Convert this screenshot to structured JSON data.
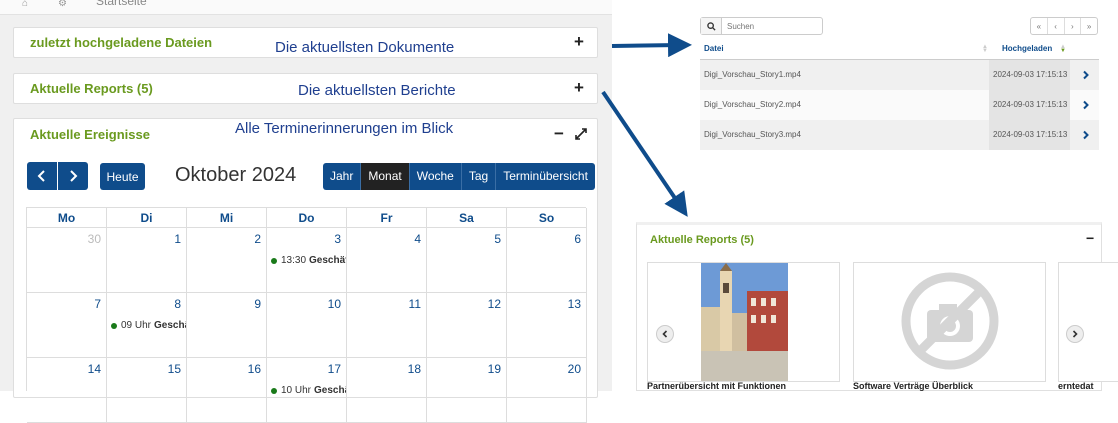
{
  "topbar": {
    "breadcrumb": "Startseite"
  },
  "panels": {
    "recent_files": {
      "title": "zuletzt hochgeladene Dateien",
      "annotation": "Die aktuellsten Dokumente",
      "toggle": "+"
    },
    "reports": {
      "title": "Aktuelle Reports (5)",
      "annotation": "Die aktuellsten Berichte",
      "toggle": "+"
    },
    "events": {
      "title": "Aktuelle Ereignisse",
      "annotation": "Alle Terminerinnerungen im Blick",
      "toggle": "−"
    }
  },
  "calendar": {
    "today_label": "Heute",
    "month_title": "Oktober 2024",
    "views": [
      "Jahr",
      "Monat",
      "Woche",
      "Tag",
      "Terminübersicht"
    ],
    "active_view": "Monat",
    "weekdays": [
      "Mo",
      "Di",
      "Mi",
      "Do",
      "Fr",
      "Sa",
      "So"
    ],
    "weeks": [
      [
        {
          "d": "30",
          "other": true
        },
        {
          "d": "1"
        },
        {
          "d": "2"
        },
        {
          "d": "3",
          "event": {
            "time": "13:30",
            "title": "Geschäf"
          }
        },
        {
          "d": "4"
        },
        {
          "d": "5"
        },
        {
          "d": "6"
        }
      ],
      [
        {
          "d": "7"
        },
        {
          "d": "8",
          "event": {
            "time": "09 Uhr",
            "title": "Geschä"
          }
        },
        {
          "d": "9"
        },
        {
          "d": "10"
        },
        {
          "d": "11"
        },
        {
          "d": "12"
        },
        {
          "d": "13"
        }
      ],
      [
        {
          "d": "14"
        },
        {
          "d": "15"
        },
        {
          "d": "16"
        },
        {
          "d": "17",
          "event": {
            "time": "10 Uhr",
            "title": "Geschä"
          }
        },
        {
          "d": "18"
        },
        {
          "d": "19"
        },
        {
          "d": "20"
        }
      ]
    ]
  },
  "files_table": {
    "search_placeholder": "Suchen",
    "pager": [
      "«",
      "‹",
      "›",
      "»"
    ],
    "col_file": "Datei",
    "col_uploaded": "Hochgeladen",
    "rows": [
      {
        "file": "Digi_Vorschau_Story1.mp4",
        "uploaded": "2024-09-03 17:15:13"
      },
      {
        "file": "Digi_Vorschau_Story2.mp4",
        "uploaded": "2024-09-03 17:15:13"
      },
      {
        "file": "Digi_Vorschau_Story3.mp4",
        "uploaded": "2024-09-03 17:15:13"
      }
    ]
  },
  "reports_panel": {
    "title": "Aktuelle Reports (5)",
    "toggle": "−",
    "cards": [
      {
        "title": "Partnerübersicht mit Funktionen"
      },
      {
        "title": "Software Verträge Überblick"
      },
      {
        "title": "erntedat"
      }
    ]
  },
  "colors": {
    "accent": "#0f4c8b",
    "title_green": "#6a9a1f",
    "annotation": "#1f3f8f"
  }
}
